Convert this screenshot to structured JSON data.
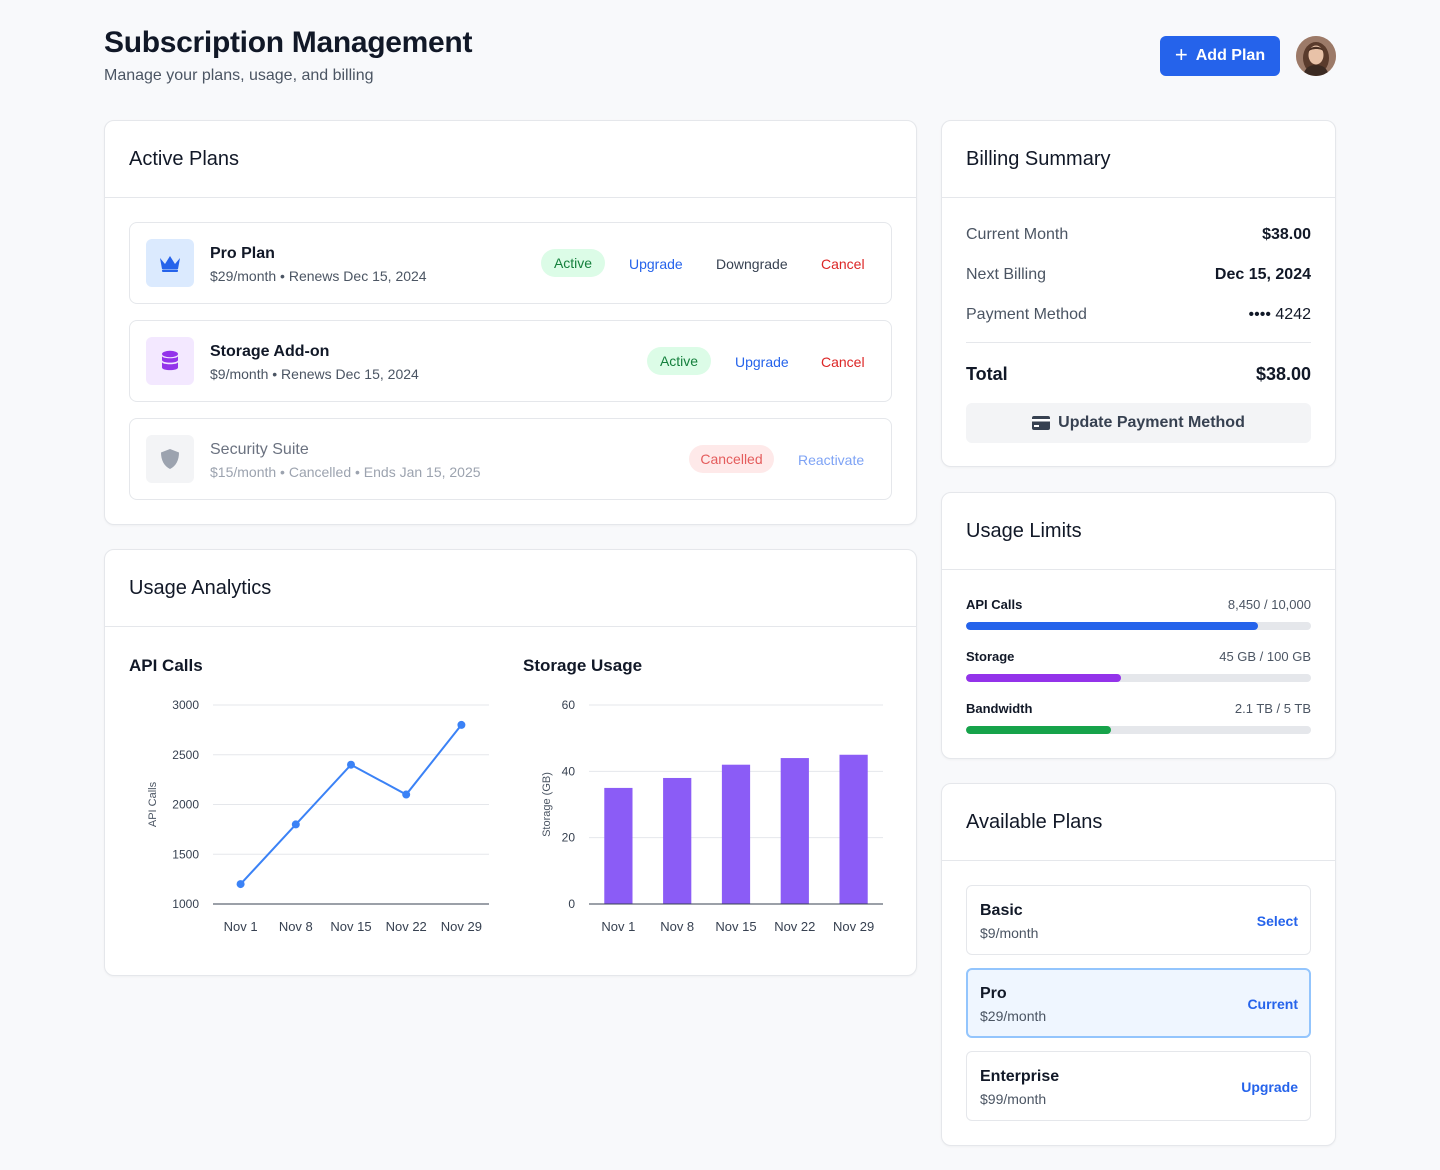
{
  "header": {
    "title": "Subscription Management",
    "subtitle": "Manage your plans, usage, and billing",
    "add_plan_label": "Add Plan"
  },
  "active_plans": {
    "title": "Active Plans",
    "plans": [
      {
        "name": "Pro Plan",
        "meta": "$29/month • Renews Dec 15, 2024",
        "status": "Active",
        "icon": "crown-icon",
        "actions": [
          "Upgrade",
          "Downgrade",
          "Cancel"
        ]
      },
      {
        "name": "Storage Add-on",
        "meta": "$9/month • Renews Dec 15, 2024",
        "status": "Active",
        "icon": "database-icon",
        "actions": [
          "Upgrade",
          "Cancel"
        ]
      },
      {
        "name": "Security Suite",
        "meta": "$15/month • Cancelled • Ends Jan 15, 2025",
        "status": "Cancelled",
        "icon": "shield-icon",
        "actions": [
          "Reactivate"
        ]
      }
    ]
  },
  "usage_analytics": {
    "title": "Usage Analytics"
  },
  "chart_data": [
    {
      "type": "line",
      "title": "API Calls",
      "xlabel": "",
      "ylabel": "API Calls",
      "categories": [
        "Nov 1",
        "Nov 8",
        "Nov 15",
        "Nov 22",
        "Nov 29"
      ],
      "values": [
        1200,
        1800,
        2400,
        2100,
        2800
      ],
      "ylim": [
        1000,
        3000
      ],
      "yticks": [
        1000,
        1500,
        2000,
        2500,
        3000
      ],
      "color": "#3b82f6",
      "grid": true
    },
    {
      "type": "bar",
      "title": "Storage Usage",
      "xlabel": "",
      "ylabel": "Storage (GB)",
      "categories": [
        "Nov 1",
        "Nov 8",
        "Nov 15",
        "Nov 22",
        "Nov 29"
      ],
      "values": [
        35,
        38,
        42,
        44,
        45
      ],
      "ylim": [
        0,
        60
      ],
      "yticks": [
        0,
        20,
        40,
        60
      ],
      "color": "#8b5cf6",
      "grid": true
    }
  ],
  "billing": {
    "title": "Billing Summary",
    "rows": [
      {
        "label": "Current Month",
        "value": "$38.00"
      },
      {
        "label": "Next Billing",
        "value": "Dec 15, 2024"
      },
      {
        "label": "Payment Method",
        "value": "•••• 4242"
      }
    ],
    "total_label": "Total",
    "total_value": "$38.00",
    "update_label": "Update Payment Method"
  },
  "usage_limits": {
    "title": "Usage Limits",
    "items": [
      {
        "label": "API Calls",
        "value": "8,450 / 10,000",
        "fraction": 0.845,
        "color": "#2563eb"
      },
      {
        "label": "Storage",
        "value": "45 GB / 100 GB",
        "fraction": 0.45,
        "color": "#9333ea"
      },
      {
        "label": "Bandwidth",
        "value": "2.1 TB / 5 TB",
        "fraction": 0.42,
        "color": "#16a34a"
      }
    ]
  },
  "available_plans": {
    "title": "Available Plans",
    "plans": [
      {
        "name": "Basic",
        "price": "$9/month",
        "action": "Select",
        "current": false
      },
      {
        "name": "Pro",
        "price": "$29/month",
        "action": "Current",
        "current": true
      },
      {
        "name": "Enterprise",
        "price": "$99/month",
        "action": "Upgrade",
        "current": false
      }
    ]
  },
  "colors": {
    "accent": "#2563eb",
    "active_badge": "#dcfce7",
    "cancelled_badge": "#fee2e2"
  }
}
